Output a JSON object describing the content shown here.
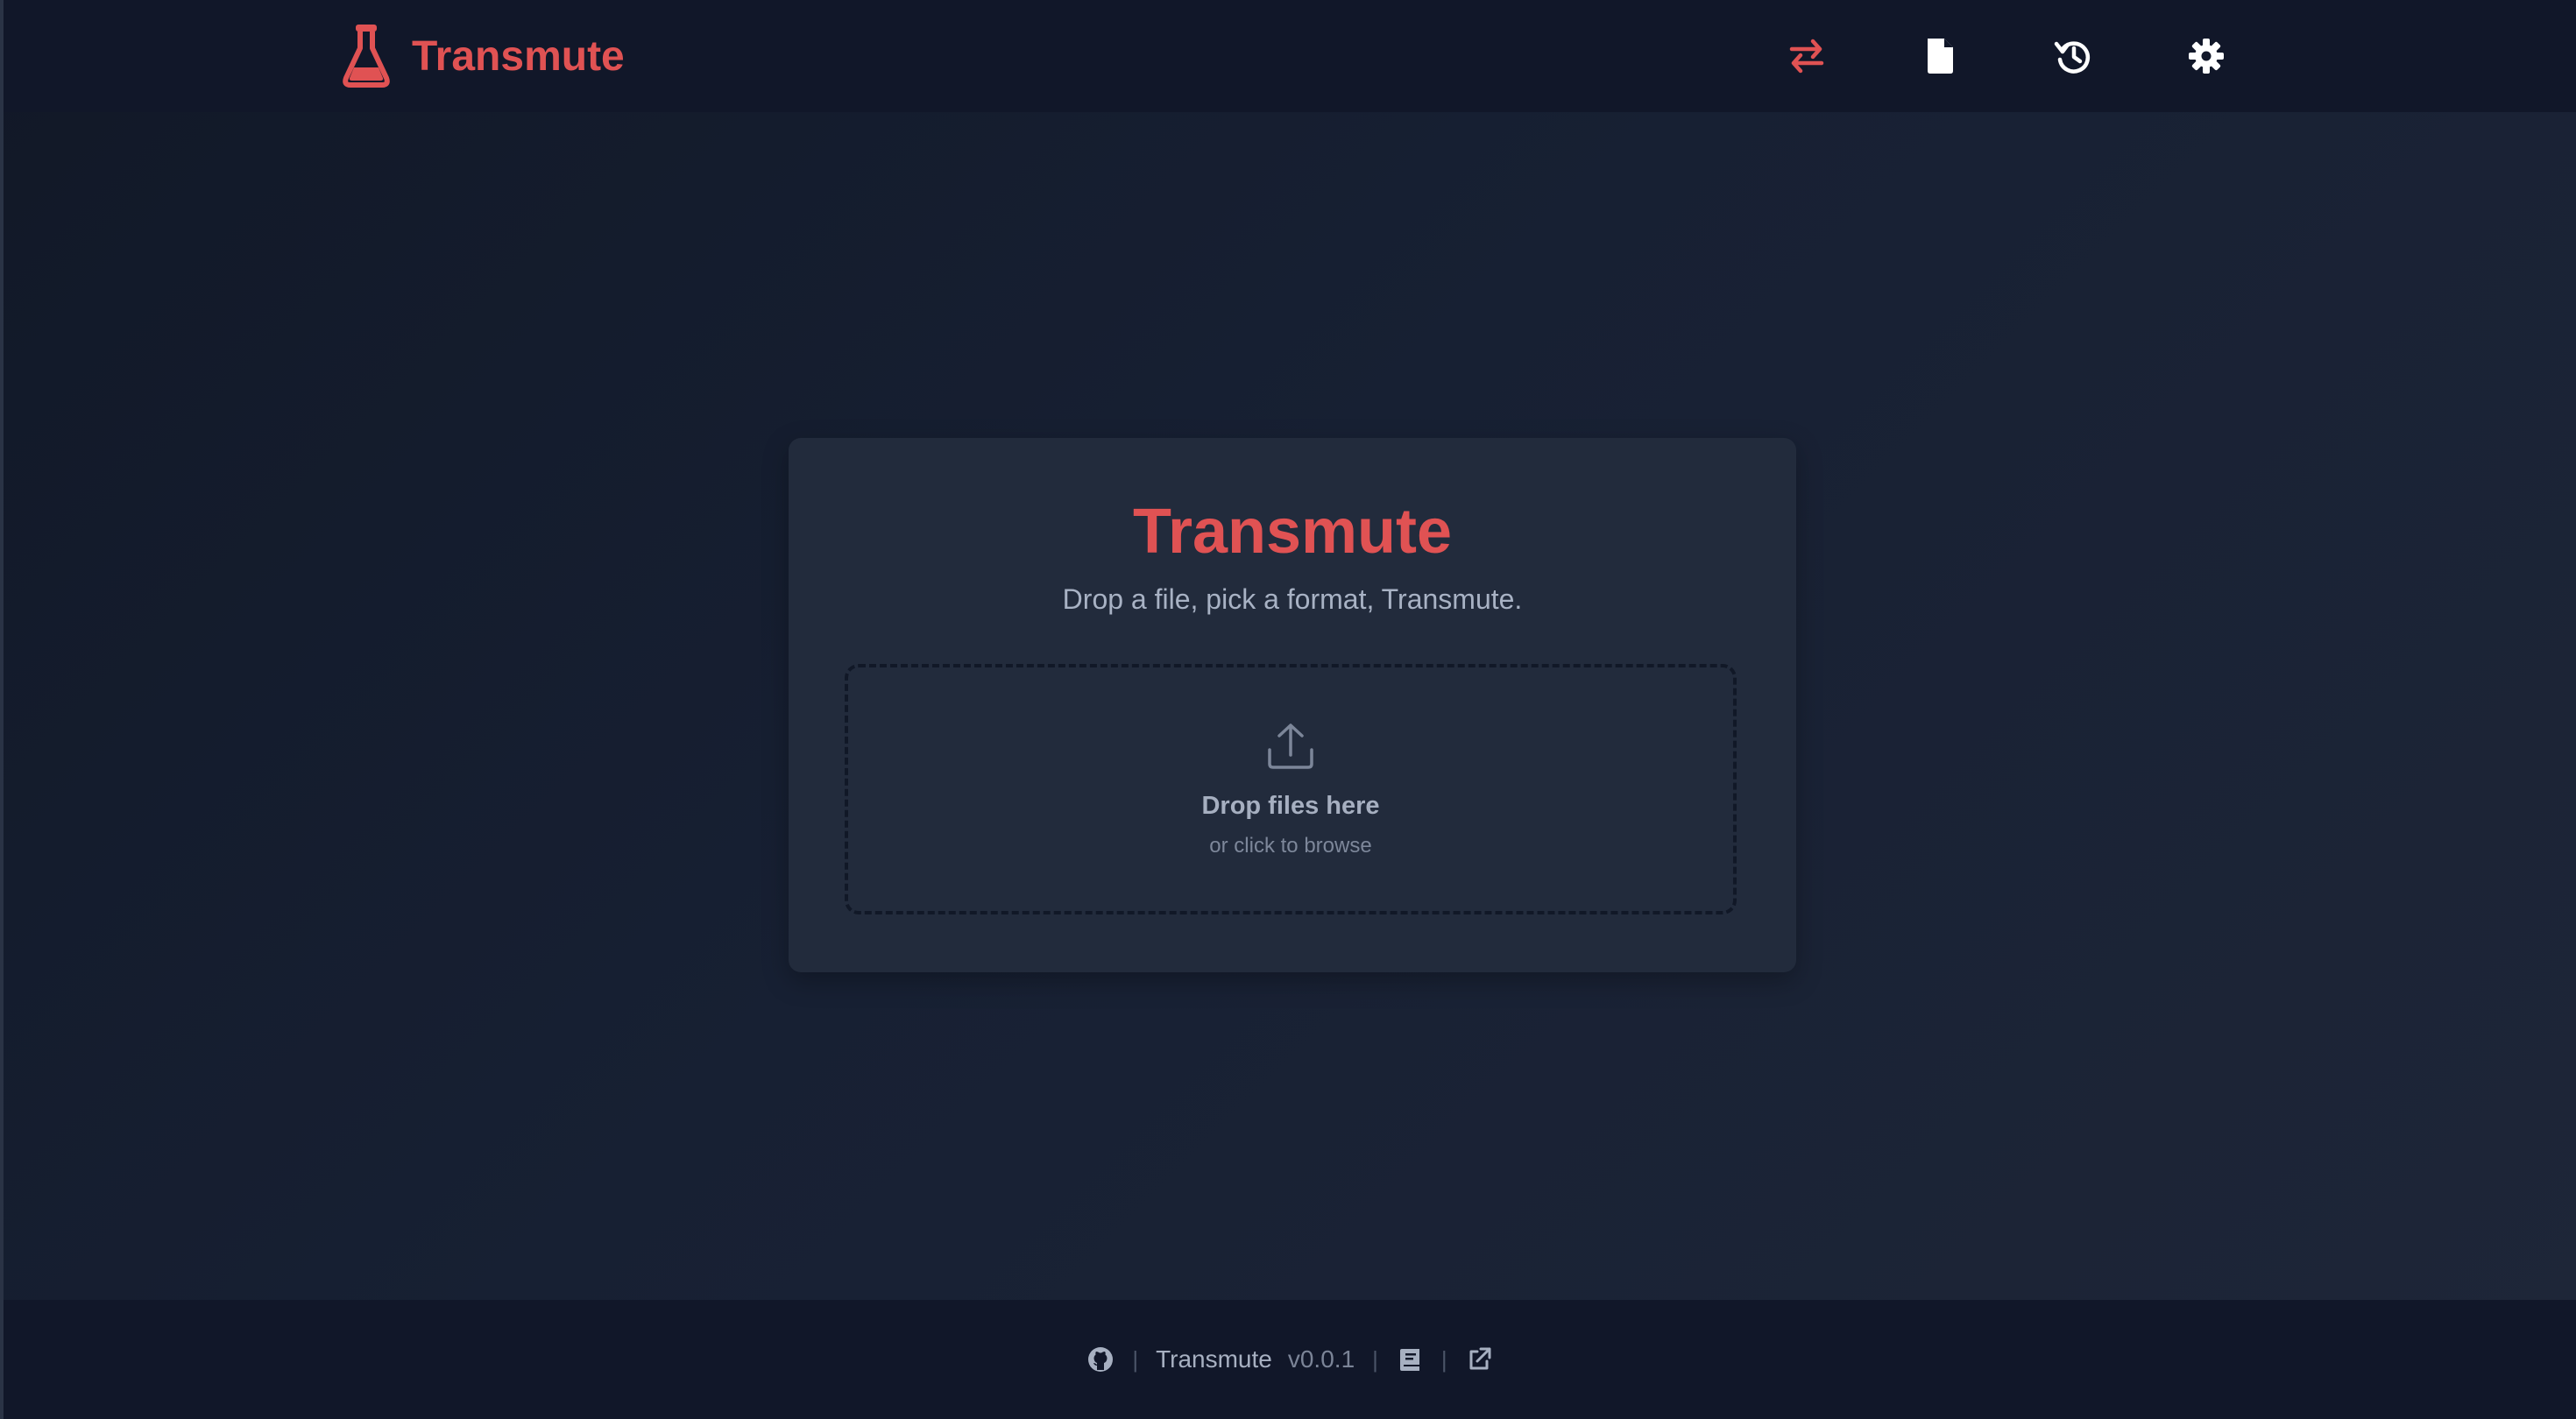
{
  "header": {
    "brand_name": "Transmute",
    "brand_icon": "flask-icon",
    "nav": [
      {
        "icon": "swap-arrows-icon",
        "color": "#e05253",
        "active": true
      },
      {
        "icon": "file-icon",
        "color": "#ffffff",
        "active": false
      },
      {
        "icon": "history-icon",
        "color": "#ffffff",
        "active": false
      },
      {
        "icon": "gear-icon",
        "color": "#ffffff",
        "active": false
      }
    ]
  },
  "main": {
    "title": "Transmute",
    "subtitle": "Drop a file, pick a format, Transmute.",
    "dropzone": {
      "icon": "upload-icon",
      "title": "Drop files here",
      "subtitle": "or click to browse"
    }
  },
  "footer": {
    "github_icon": "github-icon",
    "app_name": "Transmute",
    "version": "v0.0.1",
    "docs_icon": "book-icon",
    "external_icon": "external-link-icon",
    "separator": "|"
  },
  "colors": {
    "accent": "#e05253",
    "background": "#111729",
    "card": "#222b3c"
  }
}
